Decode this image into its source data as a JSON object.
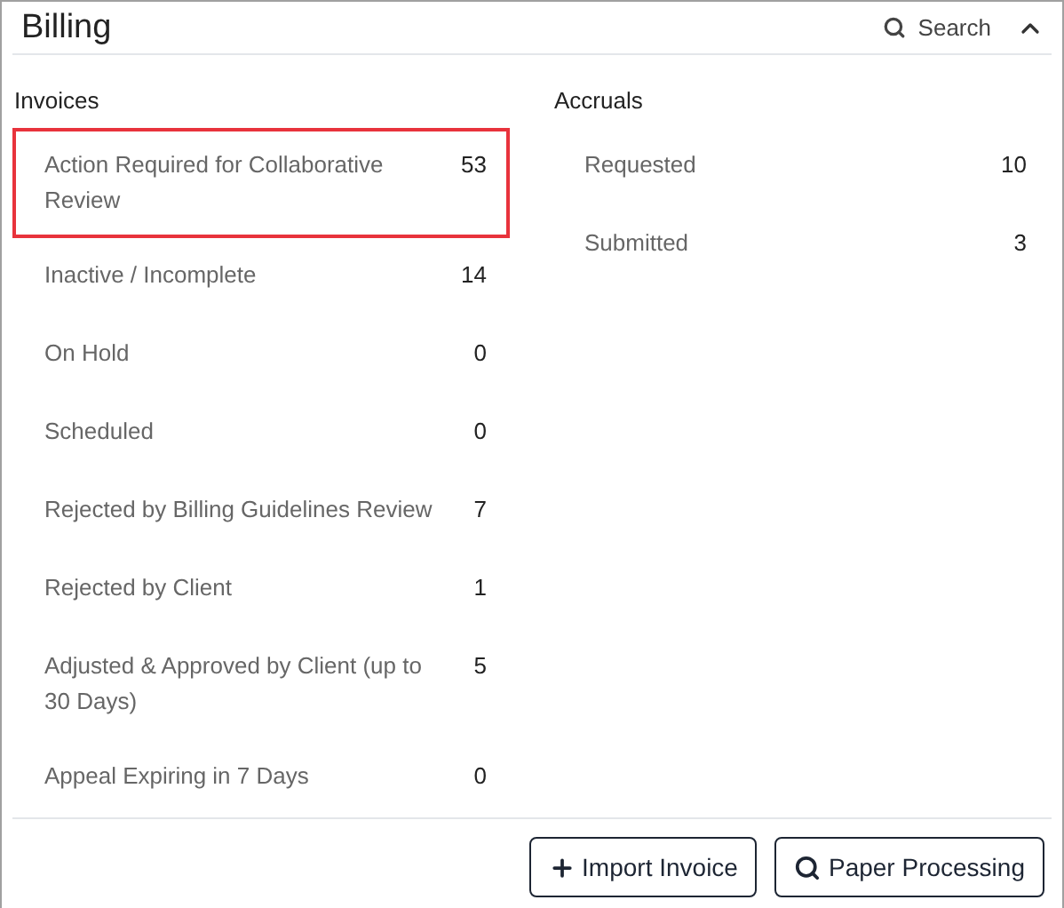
{
  "title": "Billing",
  "search": {
    "label": "Search"
  },
  "collapse": {
    "expanded": true
  },
  "invoices": {
    "heading": "Invoices",
    "items": [
      {
        "label": "Action Required for Collaborative Review",
        "count": "53",
        "highlighted": true
      },
      {
        "label": "Inactive / Incomplete",
        "count": "14",
        "highlighted": false
      },
      {
        "label": "On Hold",
        "count": "0",
        "highlighted": false
      },
      {
        "label": "Scheduled",
        "count": "0",
        "highlighted": false
      },
      {
        "label": "Rejected by Billing Guidelines Review",
        "count": "7",
        "highlighted": false
      },
      {
        "label": "Rejected by Client",
        "count": "1",
        "highlighted": false
      },
      {
        "label": "Adjusted & Approved by Client (up to 30 Days)",
        "count": "5",
        "highlighted": false
      },
      {
        "label": "Appeal Expiring in 7 Days",
        "count": "0",
        "highlighted": false
      }
    ]
  },
  "accruals": {
    "heading": "Accruals",
    "items": [
      {
        "label": "Requested",
        "count": "10",
        "highlighted": false
      },
      {
        "label": "Submitted",
        "count": "3",
        "highlighted": false
      }
    ]
  },
  "buttons": [
    {
      "kind": "import",
      "label": "Import Invoice"
    },
    {
      "kind": "search",
      "label": "Paper Processing"
    }
  ]
}
